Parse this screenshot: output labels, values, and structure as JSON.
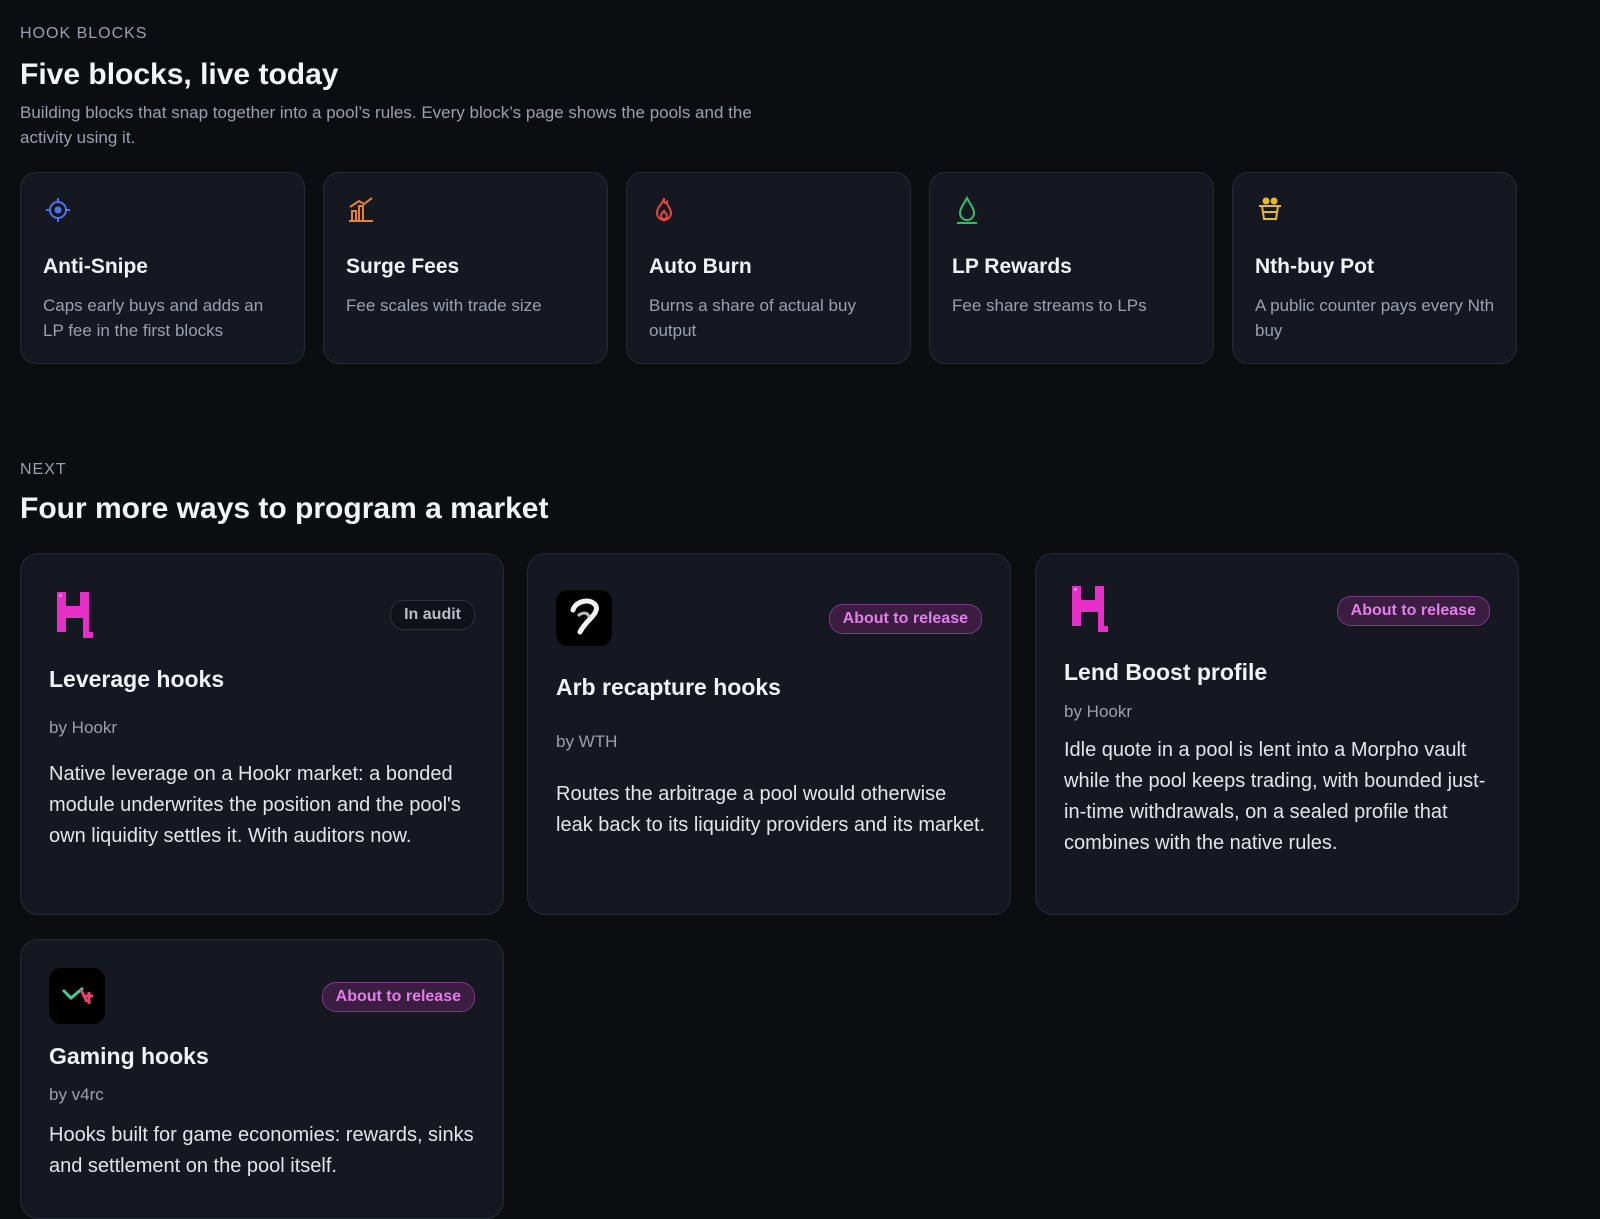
{
  "section1": {
    "eyebrow": "HOOK BLOCKS",
    "title": "Five blocks, live today",
    "subtitle": "Building blocks that snap together into a pool’s rules. Every block’s page shows the pools and the activity using it."
  },
  "blocks": [
    {
      "icon": "crosshair-icon",
      "color": "#4f73e8",
      "title": "Anti-Snipe",
      "desc": "Caps early buys and adds an LP fee in the first blocks"
    },
    {
      "icon": "bar-chart-icon",
      "color": "#e8842b",
      "title": "Surge Fees",
      "desc": "Fee scales with trade size"
    },
    {
      "icon": "flame-icon",
      "color": "#e8483a",
      "title": "Auto Burn",
      "desc": "Burns a share of actual buy output"
    },
    {
      "icon": "droplet-icon",
      "color": "#2fbf6b",
      "title": "LP Rewards",
      "desc": "Fee share streams to LPs"
    },
    {
      "icon": "pot-icon",
      "color": "#e8b92b",
      "title": "Nth-buy Pot",
      "desc": "A public counter pays every Nth buy"
    }
  ],
  "section2": {
    "eyebrow": "NEXT",
    "title": "Four more ways to program a market"
  },
  "cards": [
    {
      "logo": "hookr-logo-icon",
      "badge": "In audit",
      "title": "Leverage hooks",
      "by": "by Hookr",
      "desc": "Native leverage on a Hookr market: a bonded module underwrites the position and the pool's own liquidity settles it. With auditors now."
    },
    {
      "logo": "wth-logo-icon",
      "badge": "About to release",
      "title": "Arb recapture hooks",
      "by": "by WTH",
      "desc": "Routes the arbitrage a pool would otherwise leak back to its liquidity providers and its market."
    },
    {
      "logo": "hookr-logo-icon",
      "badge": "About to release",
      "title": "Lend Boost profile",
      "by": "by Hookr",
      "desc": "Idle quote in a pool is lent into a Morpho vault while the pool keeps trading, with bounded just-in-time withdrawals, on a sealed profile that combines with the native rules."
    },
    {
      "logo": "v4rc-logo-icon",
      "badge": "About to release",
      "title": "Gaming hooks",
      "by": "by v4rc",
      "desc": "Hooks built for game economies: rewards, sinks and settlement on the pool itself."
    }
  ]
}
